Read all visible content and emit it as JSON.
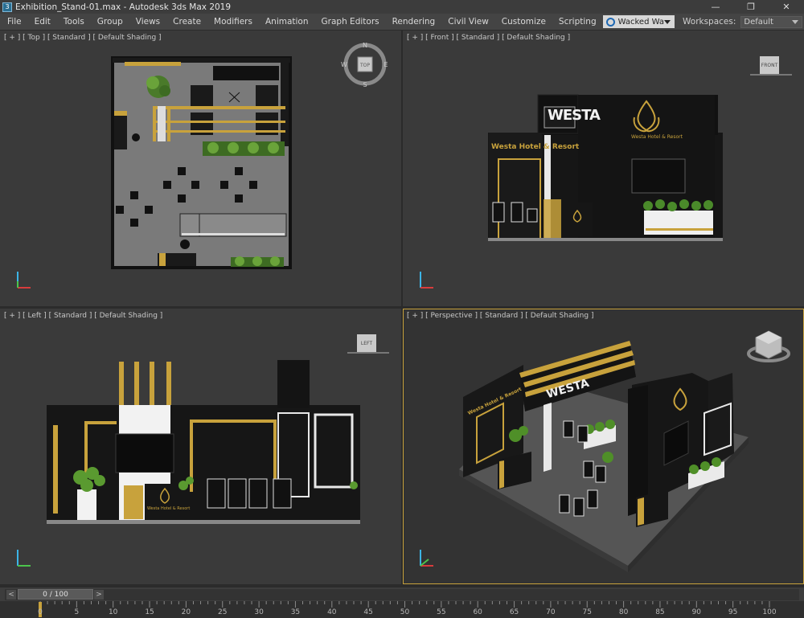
{
  "window": {
    "title": "Exhibition_Stand-01.max - Autodesk 3ds Max 2019",
    "minimize": "—",
    "restore": "❐",
    "close": "✕"
  },
  "menu": [
    "File",
    "Edit",
    "Tools",
    "Group",
    "Views",
    "Create",
    "Modifiers",
    "Animation",
    "Graph Editors",
    "Rendering",
    "Civil View",
    "Customize",
    "Scripting"
  ],
  "user": {
    "name": "Wacked Wa"
  },
  "workspaces": {
    "label": "Workspaces:",
    "value": "Default"
  },
  "viewports": {
    "top": {
      "label": "[ + ] [ Top ] [ Standard ] [ Default Shading ]",
      "cube": "TOP"
    },
    "front": {
      "label": "[ + ] [ Front ] [ Standard ] [ Default Shading ]",
      "cube": "FRONT",
      "sign_big": "WESTA",
      "sign_hotel": "Westa Hotel & Resort",
      "sign_small": "Westa Hotel & Resort"
    },
    "left": {
      "label": "[ + ] [ Left ] [ Standard ] [ Default Shading ]",
      "cube": "LEFT",
      "sign_small": "Westa Hotel & Resort"
    },
    "perspective": {
      "label": "[ + ] [ Perspective ] [ Standard ] [ Default Shading ]",
      "sign_big": "WESTA",
      "sign_hotel": "Westa Hotel & Resort"
    }
  },
  "compass": {
    "n": "N",
    "s": "S",
    "e": "E",
    "w": "W"
  },
  "timeslider": {
    "value": "0 / 100",
    "prev": "<",
    "next": ">"
  },
  "ticks": [
    "0",
    "5",
    "10",
    "15",
    "20",
    "25",
    "30",
    "35",
    "40",
    "45",
    "50",
    "55",
    "60",
    "65",
    "70",
    "75",
    "80",
    "85",
    "90",
    "95",
    "100"
  ],
  "colors": {
    "gold": "#c8a23c",
    "accent_blue": "#1d68b3"
  }
}
